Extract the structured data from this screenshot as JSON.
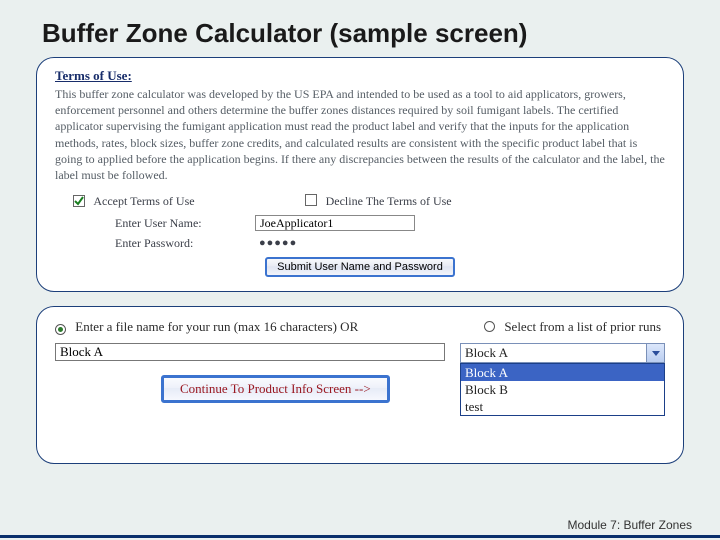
{
  "slide": {
    "title": "Buffer Zone Calculator (sample screen)"
  },
  "terms": {
    "heading": "Terms of Use:",
    "body": "This buffer zone calculator was developed by the US EPA and intended to be used as a tool to aid applicators, growers, enforcement personnel and others determine the buffer zones distances required by soil fumigant labels. The certified applicator supervising the fumigant application must read the product label and verify that the inputs for the application methods, rates, block sizes, buffer zone credits, and calculated results are consistent with the specific product label that is going to applied before the application begins. If there any discrepancies between the results of the calculator and the label, the label must be followed.",
    "accept_label": "Accept Terms of Use",
    "decline_label": "Decline The Terms of Use",
    "accept_checked": true,
    "decline_checked": false
  },
  "login": {
    "username_label": "Enter User Name:",
    "password_label": "Enter Password:",
    "username_value": "JoeApplicator1",
    "password_masked": "●●●●●",
    "submit_label": "Submit User Name and Password"
  },
  "run": {
    "enter_label": "Enter a file name for your run (max 16 characters) OR",
    "select_label": "Select from a list of prior runs",
    "mode": "enter",
    "file_name_value": "Block A",
    "combo_selected": "Block A",
    "combo_items": [
      "Block A",
      "Block B",
      "test"
    ],
    "highlighted_index": 0,
    "continue_label": "Continue To Product Info Screen -->"
  },
  "footer": {
    "text": "Module 7: Buffer Zones"
  }
}
